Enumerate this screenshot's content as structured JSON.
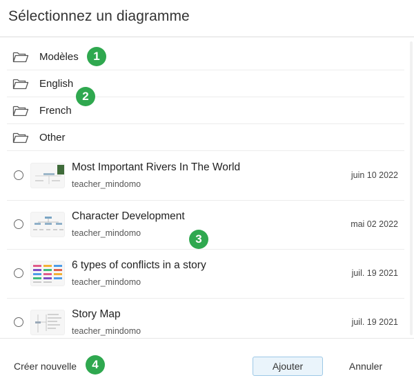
{
  "dialog": {
    "title": "Sélectionnez un diagramme"
  },
  "folders": [
    {
      "label": "Modèles",
      "icon": "folder-icon"
    },
    {
      "label": "English",
      "icon": "folder-icon"
    },
    {
      "label": "French",
      "icon": "folder-icon"
    },
    {
      "label": "Other",
      "icon": "folder-icon"
    }
  ],
  "items": [
    {
      "title": "Most Important Rivers In The World",
      "author": "teacher_mindomo",
      "date": "juin 10 2022",
      "selected": false,
      "thumbnail": "mind-map-thumbnail"
    },
    {
      "title": "Character Development",
      "author": "teacher_mindomo",
      "date": "mai 02 2022",
      "selected": false,
      "thumbnail": "org-chart-thumbnail"
    },
    {
      "title": "6 types of conflicts in a story",
      "author": "teacher_mindomo",
      "date": "juil. 19 2021",
      "selected": false,
      "thumbnail": "colored-blocks-thumbnail"
    },
    {
      "title": "Story Map",
      "author": "teacher_mindomo",
      "date": "juil. 19 2021",
      "selected": false,
      "thumbnail": "story-map-thumbnail"
    }
  ],
  "footer": {
    "create_label": "Créer nouvelle",
    "add_label": "Ajouter",
    "cancel_label": "Annuler"
  },
  "badges": [
    "1",
    "2",
    "3",
    "4"
  ],
  "colors": {
    "badge": "#2fa84f",
    "add_button_bg": "#eaf4fb",
    "add_button_border": "#9cc8e6"
  }
}
